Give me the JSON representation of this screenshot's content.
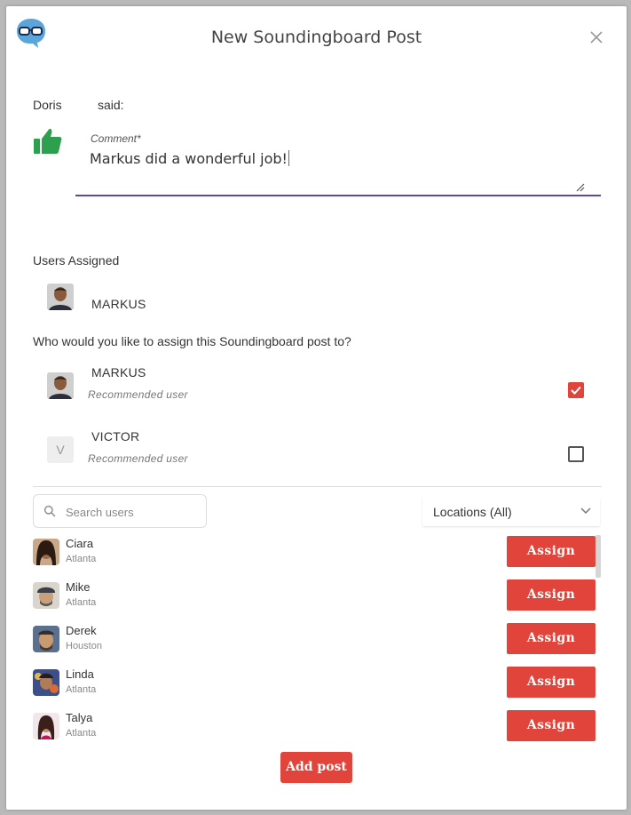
{
  "modal": {
    "title": "New Soundingboard Post",
    "logo_icon": "glasses-speech-bubble-icon",
    "close_icon": "close-icon"
  },
  "post": {
    "author": "Doris",
    "said": "said:",
    "sentiment_icon": "thumbs-up-icon",
    "comment_label": "Comment*",
    "comment_value": "Markus did a wonderful job!"
  },
  "assigned": {
    "label": "Users Assigned",
    "users": [
      {
        "name": "MARKUS",
        "avatar_icon": "user-photo-icon"
      }
    ]
  },
  "recommend": {
    "question": "Who would you like to assign this Soundingboard post to?",
    "users": [
      {
        "name": "MARKUS",
        "subtitle": "Recommended user",
        "initial": "",
        "checked": true
      },
      {
        "name": "VICTOR",
        "subtitle": "Recommended user",
        "initial": "V",
        "checked": false
      }
    ]
  },
  "search": {
    "placeholder": "Search users",
    "value": ""
  },
  "locations": {
    "selected": "Locations (All)"
  },
  "user_list": [
    {
      "name": "Ciara",
      "location": "Atlanta",
      "action": "Assign"
    },
    {
      "name": "Mike",
      "location": "Atlanta",
      "action": "Assign"
    },
    {
      "name": "Derek",
      "location": "Houston",
      "action": "Assign"
    },
    {
      "name": "Linda",
      "location": "Atlanta",
      "action": "Assign"
    },
    {
      "name": "Talya",
      "location": "Atlanta",
      "action": "Assign"
    }
  ],
  "footer": {
    "add_post": "Add post"
  },
  "colors": {
    "accent_red": "#e0443a",
    "thumb_green": "#2e9e4f",
    "focus_purple": "#5c47a6",
    "logo_blue": "#5aa6dc"
  }
}
